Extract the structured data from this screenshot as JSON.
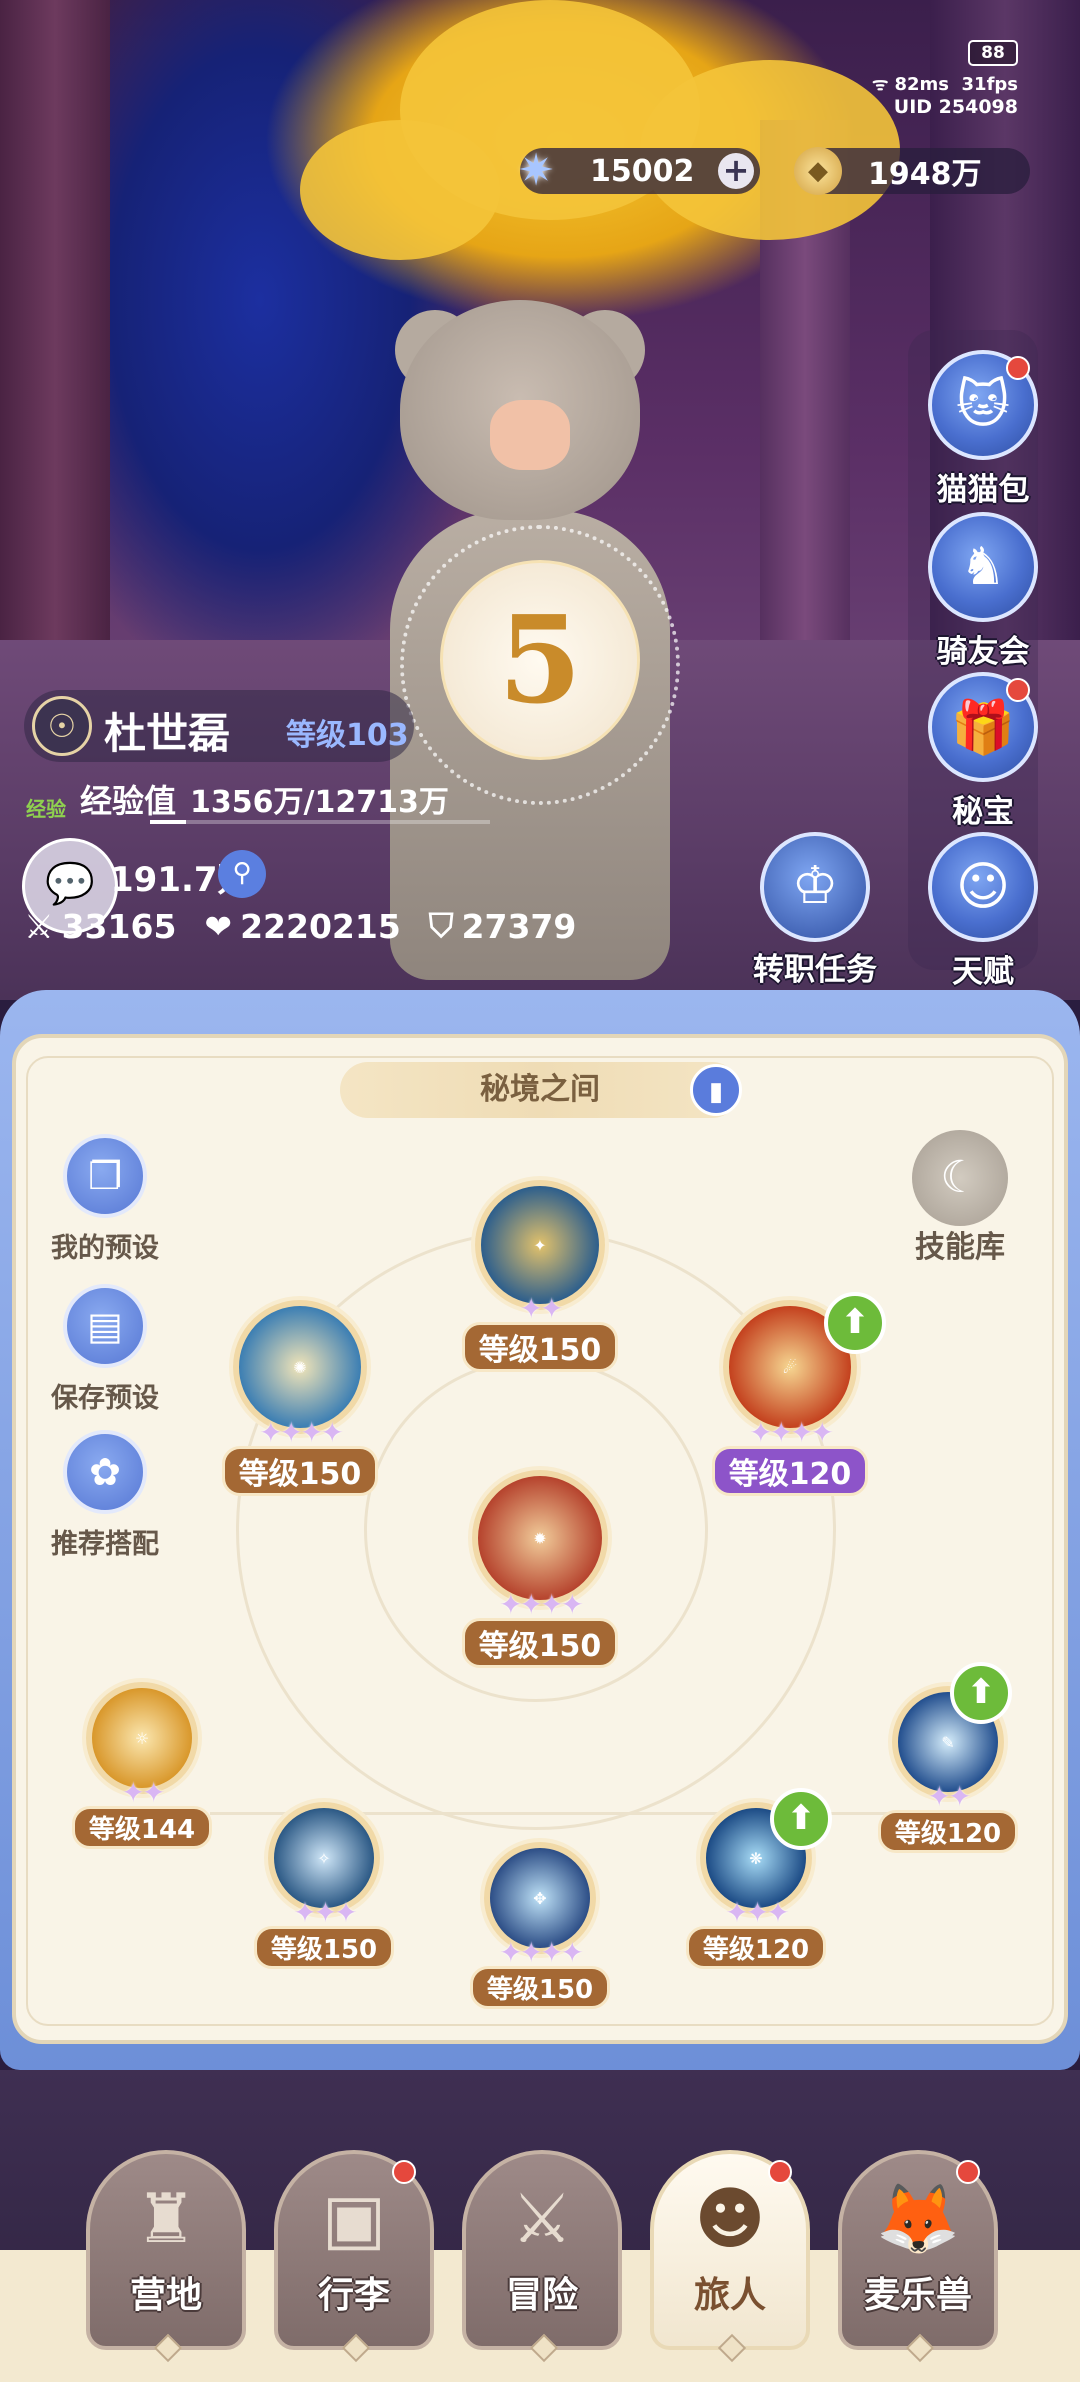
{
  "status": {
    "battery": "88",
    "ping": "82ms",
    "fps": "31fps",
    "uid": "UID  254098"
  },
  "currency": {
    "gems": "15002",
    "coins": "1948万"
  },
  "side_menu": {
    "items": [
      {
        "label": "猫猫包",
        "icon": "cat-bag-icon",
        "badge": true
      },
      {
        "label": "骑友会",
        "icon": "horse-icon",
        "badge": false
      },
      {
        "label": "秘宝",
        "icon": "treasure-icon",
        "badge": true
      },
      {
        "label": "天赋",
        "icon": "talent-icon",
        "badge": false
      }
    ],
    "job": {
      "label": "转职任务",
      "icon": "job-change-icon"
    }
  },
  "player": {
    "avatar_level": "5",
    "name": "杜世磊",
    "level": "等级103",
    "exp_tag": "经验",
    "exp_label": "经验值",
    "exp_value": "1356万/12713万",
    "exp_fraction": 0.107,
    "power": "191.7万",
    "attack": "33165",
    "hp": "2220215",
    "defense": "27379"
  },
  "panel": {
    "title": "秘境之间",
    "tools": {
      "my_presets": "我的预设",
      "save_preset": "保存预设",
      "recommended": "推荐搭配",
      "skill_library": "技能库"
    },
    "skills": [
      {
        "id": "top",
        "level": "等级150",
        "stars": "✦✦",
        "upgrade": false
      },
      {
        "id": "left",
        "level": "等级150",
        "stars": "✦✦✦✦",
        "upgrade": false
      },
      {
        "id": "right",
        "level": "等级120",
        "stars": "✦✦✦✦",
        "upgrade": true
      },
      {
        "id": "center",
        "level": "等级150",
        "stars": "✦✦✦✦",
        "upgrade": false
      },
      {
        "id": "b1",
        "level": "等级144",
        "stars": "✦✦",
        "upgrade": false
      },
      {
        "id": "b2",
        "level": "等级150",
        "stars": "✦✦✦",
        "upgrade": false
      },
      {
        "id": "b3",
        "level": "等级150",
        "stars": "✦✦✦✦",
        "upgrade": false
      },
      {
        "id": "b4",
        "level": "等级120",
        "stars": "✦✦✦",
        "upgrade": true
      },
      {
        "id": "b5",
        "level": "等级120",
        "stars": "✦✦",
        "upgrade": true
      }
    ]
  },
  "nav": {
    "items": [
      {
        "label": "营地",
        "badge": false,
        "active": false
      },
      {
        "label": "行李",
        "badge": true,
        "active": false
      },
      {
        "label": "冒险",
        "badge": false,
        "active": false
      },
      {
        "label": "旅人",
        "badge": true,
        "active": true
      },
      {
        "label": "麦乐兽",
        "badge": true,
        "active": false
      }
    ]
  },
  "colors": {
    "panel_bg": "#f9f4e7",
    "level_badge": "#a46834",
    "level_badge_upgrade": "#8d54c9",
    "upgrade": "#6dbb3a",
    "alert": "#e5483d"
  }
}
